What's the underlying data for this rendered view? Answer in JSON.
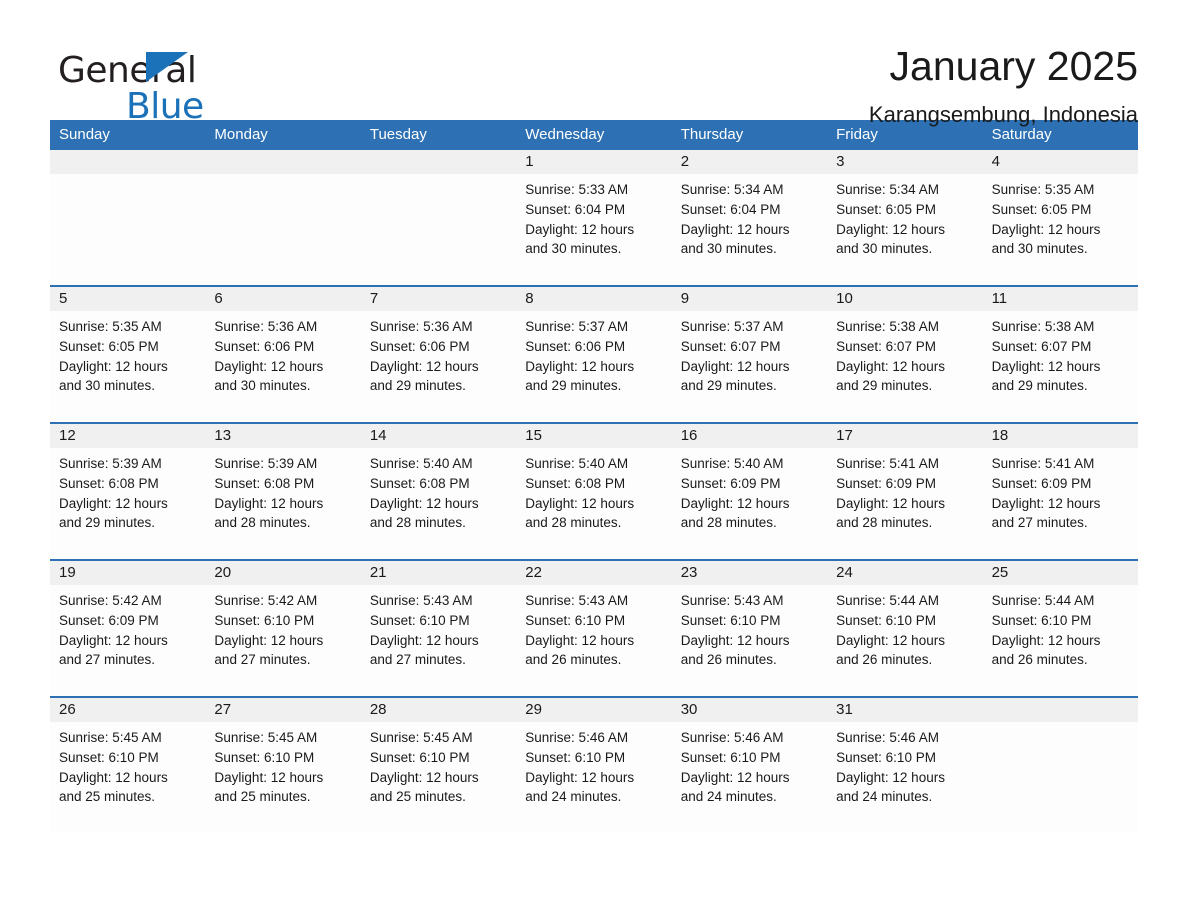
{
  "brand": {
    "name_part1": "General",
    "name_part2": "Blue",
    "triangle_color": "#1b72b8"
  },
  "header": {
    "month_title": "January 2025",
    "location": "Karangsembung, Indonesia"
  },
  "theme": {
    "header_blue": "#2d71b4",
    "day_band_gray": "#f0f0f0",
    "text_color": "#1a1a1a"
  },
  "calendar": {
    "weekdays": [
      "Sunday",
      "Monday",
      "Tuesday",
      "Wednesday",
      "Thursday",
      "Friday",
      "Saturday"
    ],
    "weeks": [
      [
        {
          "day": "",
          "sunrise": "",
          "sunset": "",
          "daylight_line1": "",
          "daylight_line2": ""
        },
        {
          "day": "",
          "sunrise": "",
          "sunset": "",
          "daylight_line1": "",
          "daylight_line2": ""
        },
        {
          "day": "",
          "sunrise": "",
          "sunset": "",
          "daylight_line1": "",
          "daylight_line2": ""
        },
        {
          "day": "1",
          "sunrise": "Sunrise: 5:33 AM",
          "sunset": "Sunset: 6:04 PM",
          "daylight_line1": "Daylight: 12 hours",
          "daylight_line2": "and 30 minutes."
        },
        {
          "day": "2",
          "sunrise": "Sunrise: 5:34 AM",
          "sunset": "Sunset: 6:04 PM",
          "daylight_line1": "Daylight: 12 hours",
          "daylight_line2": "and 30 minutes."
        },
        {
          "day": "3",
          "sunrise": "Sunrise: 5:34 AM",
          "sunset": "Sunset: 6:05 PM",
          "daylight_line1": "Daylight: 12 hours",
          "daylight_line2": "and 30 minutes."
        },
        {
          "day": "4",
          "sunrise": "Sunrise: 5:35 AM",
          "sunset": "Sunset: 6:05 PM",
          "daylight_line1": "Daylight: 12 hours",
          "daylight_line2": "and 30 minutes."
        }
      ],
      [
        {
          "day": "5",
          "sunrise": "Sunrise: 5:35 AM",
          "sunset": "Sunset: 6:05 PM",
          "daylight_line1": "Daylight: 12 hours",
          "daylight_line2": "and 30 minutes."
        },
        {
          "day": "6",
          "sunrise": "Sunrise: 5:36 AM",
          "sunset": "Sunset: 6:06 PM",
          "daylight_line1": "Daylight: 12 hours",
          "daylight_line2": "and 30 minutes."
        },
        {
          "day": "7",
          "sunrise": "Sunrise: 5:36 AM",
          "sunset": "Sunset: 6:06 PM",
          "daylight_line1": "Daylight: 12 hours",
          "daylight_line2": "and 29 minutes."
        },
        {
          "day": "8",
          "sunrise": "Sunrise: 5:37 AM",
          "sunset": "Sunset: 6:06 PM",
          "daylight_line1": "Daylight: 12 hours",
          "daylight_line2": "and 29 minutes."
        },
        {
          "day": "9",
          "sunrise": "Sunrise: 5:37 AM",
          "sunset": "Sunset: 6:07 PM",
          "daylight_line1": "Daylight: 12 hours",
          "daylight_line2": "and 29 minutes."
        },
        {
          "day": "10",
          "sunrise": "Sunrise: 5:38 AM",
          "sunset": "Sunset: 6:07 PM",
          "daylight_line1": "Daylight: 12 hours",
          "daylight_line2": "and 29 minutes."
        },
        {
          "day": "11",
          "sunrise": "Sunrise: 5:38 AM",
          "sunset": "Sunset: 6:07 PM",
          "daylight_line1": "Daylight: 12 hours",
          "daylight_line2": "and 29 minutes."
        }
      ],
      [
        {
          "day": "12",
          "sunrise": "Sunrise: 5:39 AM",
          "sunset": "Sunset: 6:08 PM",
          "daylight_line1": "Daylight: 12 hours",
          "daylight_line2": "and 29 minutes."
        },
        {
          "day": "13",
          "sunrise": "Sunrise: 5:39 AM",
          "sunset": "Sunset: 6:08 PM",
          "daylight_line1": "Daylight: 12 hours",
          "daylight_line2": "and 28 minutes."
        },
        {
          "day": "14",
          "sunrise": "Sunrise: 5:40 AM",
          "sunset": "Sunset: 6:08 PM",
          "daylight_line1": "Daylight: 12 hours",
          "daylight_line2": "and 28 minutes."
        },
        {
          "day": "15",
          "sunrise": "Sunrise: 5:40 AM",
          "sunset": "Sunset: 6:08 PM",
          "daylight_line1": "Daylight: 12 hours",
          "daylight_line2": "and 28 minutes."
        },
        {
          "day": "16",
          "sunrise": "Sunrise: 5:40 AM",
          "sunset": "Sunset: 6:09 PM",
          "daylight_line1": "Daylight: 12 hours",
          "daylight_line2": "and 28 minutes."
        },
        {
          "day": "17",
          "sunrise": "Sunrise: 5:41 AM",
          "sunset": "Sunset: 6:09 PM",
          "daylight_line1": "Daylight: 12 hours",
          "daylight_line2": "and 28 minutes."
        },
        {
          "day": "18",
          "sunrise": "Sunrise: 5:41 AM",
          "sunset": "Sunset: 6:09 PM",
          "daylight_line1": "Daylight: 12 hours",
          "daylight_line2": "and 27 minutes."
        }
      ],
      [
        {
          "day": "19",
          "sunrise": "Sunrise: 5:42 AM",
          "sunset": "Sunset: 6:09 PM",
          "daylight_line1": "Daylight: 12 hours",
          "daylight_line2": "and 27 minutes."
        },
        {
          "day": "20",
          "sunrise": "Sunrise: 5:42 AM",
          "sunset": "Sunset: 6:10 PM",
          "daylight_line1": "Daylight: 12 hours",
          "daylight_line2": "and 27 minutes."
        },
        {
          "day": "21",
          "sunrise": "Sunrise: 5:43 AM",
          "sunset": "Sunset: 6:10 PM",
          "daylight_line1": "Daylight: 12 hours",
          "daylight_line2": "and 27 minutes."
        },
        {
          "day": "22",
          "sunrise": "Sunrise: 5:43 AM",
          "sunset": "Sunset: 6:10 PM",
          "daylight_line1": "Daylight: 12 hours",
          "daylight_line2": "and 26 minutes."
        },
        {
          "day": "23",
          "sunrise": "Sunrise: 5:43 AM",
          "sunset": "Sunset: 6:10 PM",
          "daylight_line1": "Daylight: 12 hours",
          "daylight_line2": "and 26 minutes."
        },
        {
          "day": "24",
          "sunrise": "Sunrise: 5:44 AM",
          "sunset": "Sunset: 6:10 PM",
          "daylight_line1": "Daylight: 12 hours",
          "daylight_line2": "and 26 minutes."
        },
        {
          "day": "25",
          "sunrise": "Sunrise: 5:44 AM",
          "sunset": "Sunset: 6:10 PM",
          "daylight_line1": "Daylight: 12 hours",
          "daylight_line2": "and 26 minutes."
        }
      ],
      [
        {
          "day": "26",
          "sunrise": "Sunrise: 5:45 AM",
          "sunset": "Sunset: 6:10 PM",
          "daylight_line1": "Daylight: 12 hours",
          "daylight_line2": "and 25 minutes."
        },
        {
          "day": "27",
          "sunrise": "Sunrise: 5:45 AM",
          "sunset": "Sunset: 6:10 PM",
          "daylight_line1": "Daylight: 12 hours",
          "daylight_line2": "and 25 minutes."
        },
        {
          "day": "28",
          "sunrise": "Sunrise: 5:45 AM",
          "sunset": "Sunset: 6:10 PM",
          "daylight_line1": "Daylight: 12 hours",
          "daylight_line2": "and 25 minutes."
        },
        {
          "day": "29",
          "sunrise": "Sunrise: 5:46 AM",
          "sunset": "Sunset: 6:10 PM",
          "daylight_line1": "Daylight: 12 hours",
          "daylight_line2": "and 24 minutes."
        },
        {
          "day": "30",
          "sunrise": "Sunrise: 5:46 AM",
          "sunset": "Sunset: 6:10 PM",
          "daylight_line1": "Daylight: 12 hours",
          "daylight_line2": "and 24 minutes."
        },
        {
          "day": "31",
          "sunrise": "Sunrise: 5:46 AM",
          "sunset": "Sunset: 6:10 PM",
          "daylight_line1": "Daylight: 12 hours",
          "daylight_line2": "and 24 minutes."
        },
        {
          "day": "",
          "sunrise": "",
          "sunset": "",
          "daylight_line1": "",
          "daylight_line2": ""
        }
      ]
    ]
  }
}
